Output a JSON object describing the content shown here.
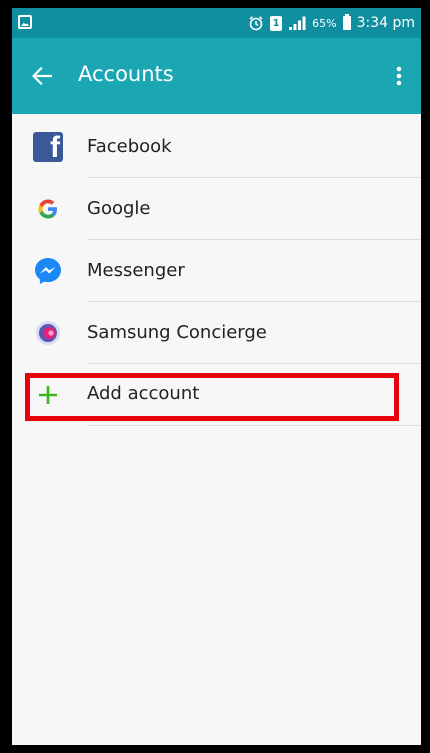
{
  "status_bar": {
    "sim_label": "1",
    "battery_percent": "65%",
    "time": "3:34 pm"
  },
  "app_bar": {
    "title": "Accounts",
    "back_icon": "arrow-left-icon",
    "menu_icon": "more-vert-icon"
  },
  "accounts": [
    {
      "label": "Facebook",
      "icon": "facebook-icon"
    },
    {
      "label": "Google",
      "icon": "google-icon"
    },
    {
      "label": "Messenger",
      "icon": "messenger-icon"
    },
    {
      "label": "Samsung Concierge",
      "icon": "samsung-concierge-icon"
    }
  ],
  "add_account": {
    "label": "Add account",
    "icon": "plus-icon",
    "highlight_color": "#e8000b"
  },
  "colors": {
    "status_bar": "#0f8e9f",
    "app_bar": "#1ba6b4",
    "background": "#f7f7f7",
    "plus": "#3cb521"
  }
}
